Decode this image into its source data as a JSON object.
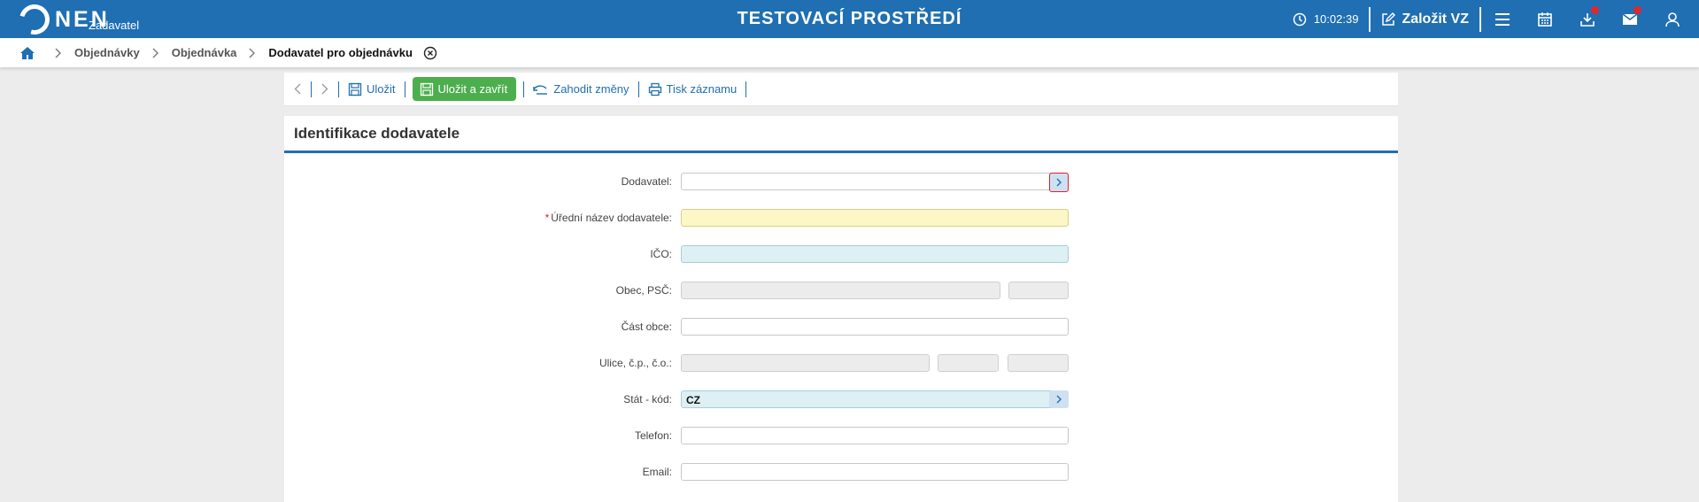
{
  "header": {
    "logo_text": "NEN",
    "logo_sub": "Zadavatel",
    "env_title": "TESTOVACÍ PROSTŘEDÍ",
    "clock_time": "10:02:39",
    "create_label": "Založit VZ",
    "icons": [
      "clock-icon",
      "edit-icon",
      "menu-icon",
      "calendar-icon",
      "download-icon",
      "mail-icon",
      "user-icon"
    ],
    "colors": {
      "brand": "#1f6fb2",
      "notification": "#e3262c"
    }
  },
  "breadcrumb": {
    "items": [
      "Objednávky",
      "Objednávka"
    ],
    "current": "Dodavatel pro objednávku"
  },
  "toolbar": {
    "save_label": "Uložit",
    "save_close_label": "Uložit a zavřít",
    "discard_label": "Zahodit změny",
    "print_label": "Tisk záznamu",
    "colors": {
      "action": "#1f6fb2",
      "primary": "#4cae4c"
    }
  },
  "form": {
    "title": "Identifikace dodavatele",
    "fields": {
      "dodavatel": {
        "label": "Dodavatel:",
        "value": ""
      },
      "nazev": {
        "label": "Úřední název dodavatele:",
        "required_mark": "*",
        "value": ""
      },
      "ico": {
        "label": "IČO:",
        "value": ""
      },
      "obec": {
        "label": "Obec, PSČ:",
        "value": "",
        "psc": ""
      },
      "cast_obce": {
        "label": "Část obce:",
        "value": ""
      },
      "ulice": {
        "label": "Ulice, č.p., č.o.:",
        "value": "",
        "cp": "",
        "co": ""
      },
      "stat": {
        "label": "Stát - kód:",
        "value": "CZ"
      },
      "telefon": {
        "label": "Telefon:",
        "value": ""
      },
      "email": {
        "label": "Email:",
        "value": ""
      }
    }
  }
}
